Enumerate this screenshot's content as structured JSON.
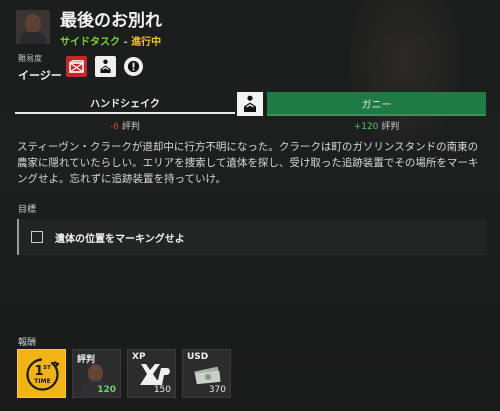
{
  "mission": {
    "title": "最後のお別れ",
    "type": "サイドタスク",
    "separator": " - ",
    "status": "進行中"
  },
  "difficulty": {
    "label": "難易度",
    "value": "イージー"
  },
  "badges": [
    "crate-icon",
    "handshake-icon",
    "alert-icon"
  ],
  "choices": {
    "left": {
      "label": "ハンドシェイク",
      "rep_value": "-6",
      "rep_label": "評判"
    },
    "right": {
      "label": "ガニー",
      "rep_value": "+120",
      "rep_label": "評判"
    },
    "icon": "handshake-icon"
  },
  "description": "スティーヴン・クラークが退却中に行方不明になった。クラークは町のガソリンスタンドの南東の農家に隠れていたらしい。エリアを捜索して遺体を探し、受け取った追跡装置でその場所をマーキングせよ。忘れずに追跡装置を持っていけ。",
  "objectives": {
    "label": "目標",
    "items": [
      {
        "text": "遺体の位置をマーキングせよ",
        "checked": false
      }
    ]
  },
  "rewards": {
    "label": "報酬",
    "items": [
      {
        "kind": "first-time",
        "label": "1ST TIME",
        "value": ""
      },
      {
        "kind": "reputation",
        "label": "評判",
        "value": "120"
      },
      {
        "kind": "xp",
        "label": "XP",
        "value": "150"
      },
      {
        "kind": "usd",
        "label": "USD",
        "value": "370"
      }
    ]
  },
  "colors": {
    "accent_green": "#1f7a45",
    "status_yellow": "#f2c21a",
    "type_green": "#7fd33a",
    "reward_gold": "#f2b316",
    "negative": "#e0413a"
  }
}
